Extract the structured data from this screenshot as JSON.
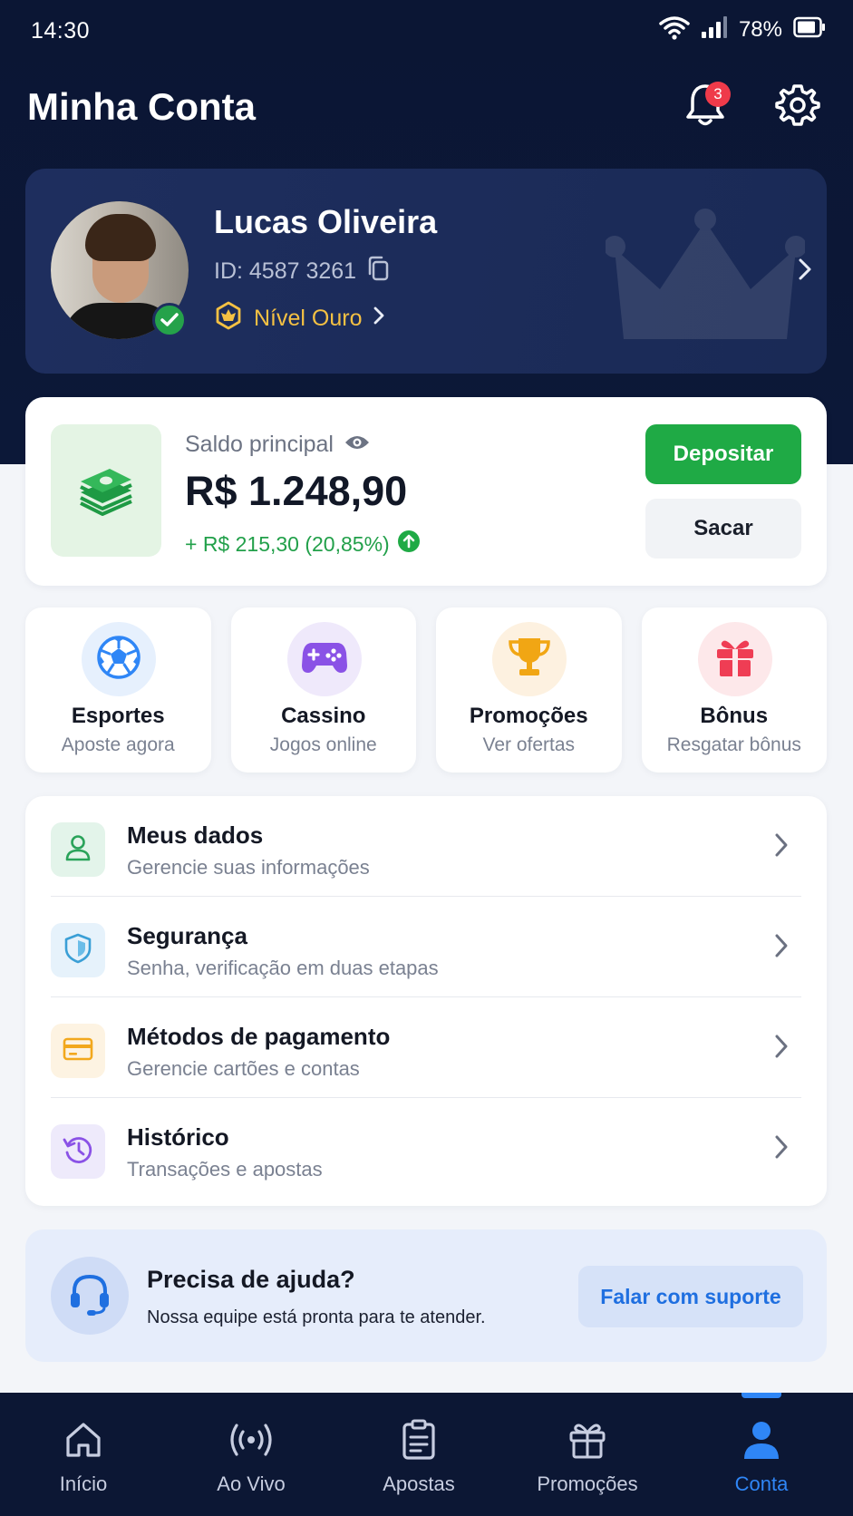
{
  "status_bar": {
    "time": "14:30",
    "battery": "78%"
  },
  "header": {
    "title": "Minha Conta",
    "notification_count": "3"
  },
  "profile": {
    "name": "Lucas Oliveira",
    "id": "ID: 4587 3261",
    "level": "Nível Ouro"
  },
  "balance": {
    "label": "Saldo principal",
    "value": "R$ 1.248,90",
    "change": "+ R$ 215,30 (20,85%)",
    "deposit_label": "Depositar",
    "withdraw_label": "Sacar"
  },
  "quick_actions": [
    {
      "title": "Esportes",
      "subtitle": "Aposte agora",
      "icon": "soccer-ball-icon",
      "bg": "#e6f0fd"
    },
    {
      "title": "Cassino",
      "subtitle": "Jogos online",
      "icon": "gamepad-icon",
      "bg": "#efe9fb"
    },
    {
      "title": "Promoções",
      "subtitle": "Ver ofertas",
      "icon": "trophy-icon",
      "bg": "#fdf1e0"
    },
    {
      "title": "Bônus",
      "subtitle": "Resgatar bônus",
      "icon": "gift-icon",
      "bg": "#fde8ea"
    }
  ],
  "menu": [
    {
      "title": "Meus dados",
      "subtitle": "Gerencie suas informações",
      "icon": "user-icon",
      "bg": "#e3f4ea"
    },
    {
      "title": "Segurança",
      "subtitle": "Senha, verificação em duas etapas",
      "icon": "shield-icon",
      "bg": "#e6f2fb"
    },
    {
      "title": "Métodos de pagamento",
      "subtitle": "Gerencie cartões e contas",
      "icon": "card-icon",
      "bg": "#fdf3e2"
    },
    {
      "title": "Histórico",
      "subtitle": "Transações e apostas",
      "icon": "history-icon",
      "bg": "#eeeafb"
    }
  ],
  "help": {
    "title": "Precisa de ajuda?",
    "subtitle": "Nossa equipe está pronta para te atender.",
    "button": "Falar com suporte"
  },
  "bottom_nav": [
    {
      "label": "Início",
      "icon": "home-icon"
    },
    {
      "label": "Ao Vivo",
      "icon": "live-icon"
    },
    {
      "label": "Apostas",
      "icon": "bet-slip-icon"
    },
    {
      "label": "Promoções",
      "icon": "gift-icon"
    },
    {
      "label": "Conta",
      "icon": "account-icon",
      "active": true
    }
  ],
  "colors": {
    "accent": "#2f86f6",
    "success": "#1faa45",
    "gold": "#f5c143",
    "navy": "#0b1634"
  }
}
